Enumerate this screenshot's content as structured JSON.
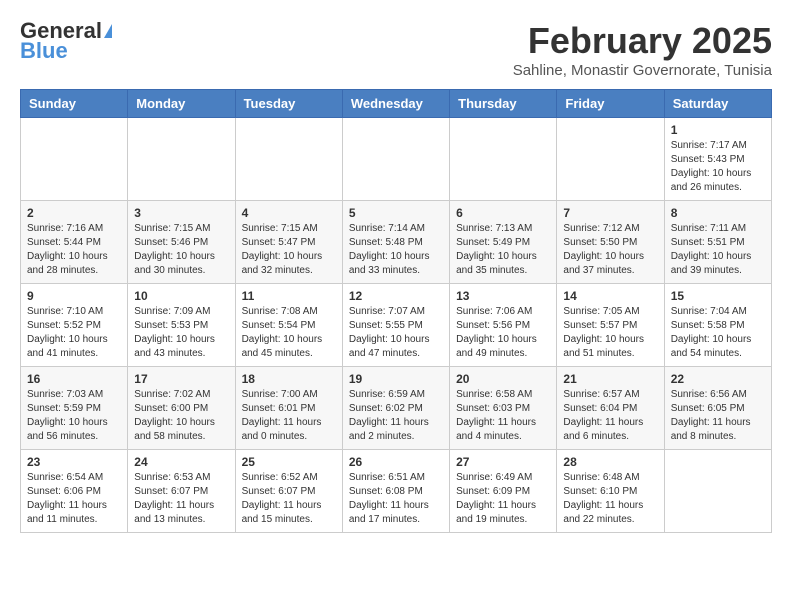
{
  "header": {
    "logo_general": "General",
    "logo_blue": "Blue",
    "month_year": "February 2025",
    "location": "Sahline, Monastir Governorate, Tunisia"
  },
  "weekdays": [
    "Sunday",
    "Monday",
    "Tuesday",
    "Wednesday",
    "Thursday",
    "Friday",
    "Saturday"
  ],
  "weeks": [
    [
      {
        "day": "",
        "info": ""
      },
      {
        "day": "",
        "info": ""
      },
      {
        "day": "",
        "info": ""
      },
      {
        "day": "",
        "info": ""
      },
      {
        "day": "",
        "info": ""
      },
      {
        "day": "",
        "info": ""
      },
      {
        "day": "1",
        "info": "Sunrise: 7:17 AM\nSunset: 5:43 PM\nDaylight: 10 hours and 26 minutes."
      }
    ],
    [
      {
        "day": "2",
        "info": "Sunrise: 7:16 AM\nSunset: 5:44 PM\nDaylight: 10 hours and 28 minutes."
      },
      {
        "day": "3",
        "info": "Sunrise: 7:15 AM\nSunset: 5:46 PM\nDaylight: 10 hours and 30 minutes."
      },
      {
        "day": "4",
        "info": "Sunrise: 7:15 AM\nSunset: 5:47 PM\nDaylight: 10 hours and 32 minutes."
      },
      {
        "day": "5",
        "info": "Sunrise: 7:14 AM\nSunset: 5:48 PM\nDaylight: 10 hours and 33 minutes."
      },
      {
        "day": "6",
        "info": "Sunrise: 7:13 AM\nSunset: 5:49 PM\nDaylight: 10 hours and 35 minutes."
      },
      {
        "day": "7",
        "info": "Sunrise: 7:12 AM\nSunset: 5:50 PM\nDaylight: 10 hours and 37 minutes."
      },
      {
        "day": "8",
        "info": "Sunrise: 7:11 AM\nSunset: 5:51 PM\nDaylight: 10 hours and 39 minutes."
      }
    ],
    [
      {
        "day": "9",
        "info": "Sunrise: 7:10 AM\nSunset: 5:52 PM\nDaylight: 10 hours and 41 minutes."
      },
      {
        "day": "10",
        "info": "Sunrise: 7:09 AM\nSunset: 5:53 PM\nDaylight: 10 hours and 43 minutes."
      },
      {
        "day": "11",
        "info": "Sunrise: 7:08 AM\nSunset: 5:54 PM\nDaylight: 10 hours and 45 minutes."
      },
      {
        "day": "12",
        "info": "Sunrise: 7:07 AM\nSunset: 5:55 PM\nDaylight: 10 hours and 47 minutes."
      },
      {
        "day": "13",
        "info": "Sunrise: 7:06 AM\nSunset: 5:56 PM\nDaylight: 10 hours and 49 minutes."
      },
      {
        "day": "14",
        "info": "Sunrise: 7:05 AM\nSunset: 5:57 PM\nDaylight: 10 hours and 51 minutes."
      },
      {
        "day": "15",
        "info": "Sunrise: 7:04 AM\nSunset: 5:58 PM\nDaylight: 10 hours and 54 minutes."
      }
    ],
    [
      {
        "day": "16",
        "info": "Sunrise: 7:03 AM\nSunset: 5:59 PM\nDaylight: 10 hours and 56 minutes."
      },
      {
        "day": "17",
        "info": "Sunrise: 7:02 AM\nSunset: 6:00 PM\nDaylight: 10 hours and 58 minutes."
      },
      {
        "day": "18",
        "info": "Sunrise: 7:00 AM\nSunset: 6:01 PM\nDaylight: 11 hours and 0 minutes."
      },
      {
        "day": "19",
        "info": "Sunrise: 6:59 AM\nSunset: 6:02 PM\nDaylight: 11 hours and 2 minutes."
      },
      {
        "day": "20",
        "info": "Sunrise: 6:58 AM\nSunset: 6:03 PM\nDaylight: 11 hours and 4 minutes."
      },
      {
        "day": "21",
        "info": "Sunrise: 6:57 AM\nSunset: 6:04 PM\nDaylight: 11 hours and 6 minutes."
      },
      {
        "day": "22",
        "info": "Sunrise: 6:56 AM\nSunset: 6:05 PM\nDaylight: 11 hours and 8 minutes."
      }
    ],
    [
      {
        "day": "23",
        "info": "Sunrise: 6:54 AM\nSunset: 6:06 PM\nDaylight: 11 hours and 11 minutes."
      },
      {
        "day": "24",
        "info": "Sunrise: 6:53 AM\nSunset: 6:07 PM\nDaylight: 11 hours and 13 minutes."
      },
      {
        "day": "25",
        "info": "Sunrise: 6:52 AM\nSunset: 6:07 PM\nDaylight: 11 hours and 15 minutes."
      },
      {
        "day": "26",
        "info": "Sunrise: 6:51 AM\nSunset: 6:08 PM\nDaylight: 11 hours and 17 minutes."
      },
      {
        "day": "27",
        "info": "Sunrise: 6:49 AM\nSunset: 6:09 PM\nDaylight: 11 hours and 19 minutes."
      },
      {
        "day": "28",
        "info": "Sunrise: 6:48 AM\nSunset: 6:10 PM\nDaylight: 11 hours and 22 minutes."
      },
      {
        "day": "",
        "info": ""
      }
    ]
  ]
}
